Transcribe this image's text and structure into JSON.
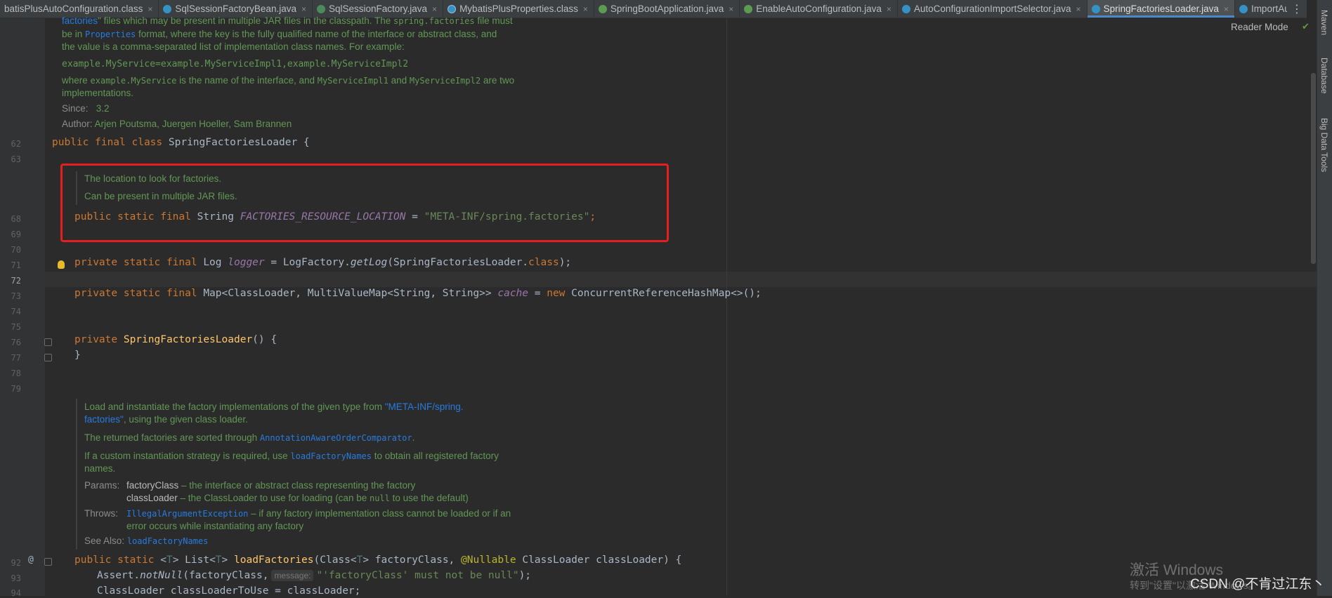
{
  "tabs": [
    {
      "label": "batisPlusAutoConfiguration.class",
      "icon": "class-file-icon"
    },
    {
      "label": "SqlSessionFactoryBean.java",
      "icon": "class-icon"
    },
    {
      "label": "SqlSessionFactory.java",
      "icon": "interface-icon"
    },
    {
      "label": "MybatisPlusProperties.class",
      "icon": "class-file-icon"
    },
    {
      "label": "SpringBootApplication.java",
      "icon": "annotation-icon"
    },
    {
      "label": "EnableAutoConfiguration.java",
      "icon": "annotation-icon"
    },
    {
      "label": "AutoConfigurationImportSelector.java",
      "icon": "class-icon"
    },
    {
      "label": "SpringFactoriesLoader.java",
      "icon": "class-icon",
      "active": true
    },
    {
      "label": "ImportAutoC",
      "icon": "class-icon"
    }
  ],
  "tab_close_glyph": "×",
  "more_glyph": "⋮",
  "reader_mode": "Reader Mode",
  "right_tools": [
    "Maven",
    "Database",
    "Big Data Tools"
  ],
  "class_doc": {
    "l1_link": "factories",
    "l1_rest": "\" files which may be present in multiple JAR files in the classpath. The ",
    "l1_mono": "spring.factories",
    "l1_end": " file must",
    "l2_a": "be in ",
    "l2_link": "Properties",
    "l2_b": " format, where the key is the fully qualified name of the interface or abstract class, and",
    "l3": "the value is a comma-separated list of implementation class names. For example:",
    "example": "example.MyService=example.MyServiceImpl1,example.MyServiceImpl2",
    "l5_a": "where ",
    "l5_m1": "example.MyService",
    "l5_b": " is the name of the interface, and ",
    "l5_m2": "MyServiceImpl1",
    "l5_c": " and ",
    "l5_m3": "MyServiceImpl2",
    "l5_d": " are two",
    "l6": "implementations.",
    "since_label": "Since:",
    "since_value": "3.2",
    "author_label": "Author:",
    "author_value": "Arjen Poutsma, Juergen Hoeller, Sam Brannen"
  },
  "line_numbers": {
    "l62": "62",
    "l63": "63",
    "l68": "68",
    "l69": "69",
    "l70": "70",
    "l71": "71",
    "l72": "72",
    "l73": "73",
    "l74": "74",
    "l75": "75",
    "l76": "76",
    "l77": "77",
    "l78": "78",
    "l79": "79",
    "l92": "92",
    "l93": "93",
    "l94": "94"
  },
  "code": {
    "l62_kw": "public final class ",
    "l62_name": "SpringFactoriesLoader {",
    "doc1_a": "The location to look for factories.",
    "doc1_b": "Can be present in multiple JAR files.",
    "l68_kw": "public static final ",
    "l68_type": "String ",
    "l68_field": "FACTORIES_RESOURCE_LOCATION",
    "l68_eq": " = ",
    "l68_str": "\"META-INF/spring.factories\"",
    "l68_end": ";",
    "l71_kw": "private static final ",
    "l71_type": "Log ",
    "l71_field": "logger",
    "l71_mid": " = LogFactory.",
    "l71_m": "getLog",
    "l71_arg": "(SpringFactoriesLoader.",
    "l71_cls": "class",
    "l71_end": ");",
    "l73_kw": "private static final ",
    "l73_type": "Map<ClassLoader, MultiValueMap<String, String>> ",
    "l73_field": "cache",
    "l73_eq": " = ",
    "l73_new": "new ",
    "l73_rest": "ConcurrentReferenceHashMap<>();",
    "l76_kw": "private ",
    "l76_name": "SpringFactoriesLoader",
    "l76_end": "() {",
    "l77": "}",
    "doc2": {
      "p1_a": "Load and instantiate the factory implementations of the given type from ",
      "p1_link": "\"META-INF/spring.",
      "p1_link2": "factories\"",
      "p1_b": ", using the given class loader.",
      "p2_a": "The returned factories are sorted through ",
      "p2_link": "AnnotationAwareOrderComparator",
      "p2_b": ".",
      "p3_a": "If a custom instantiation strategy is required, use ",
      "p3_link": "loadFactoryNames",
      "p3_b": " to obtain all registered factory",
      "p3_c": "names.",
      "params_label": "Params:",
      "param1_name": "factoryClass",
      "param1_desc": " – the interface or abstract class representing the factory",
      "param2_name": "classLoader",
      "param2_desc_a": " – the ClassLoader to use for loading (can be ",
      "param2_null": "null",
      "param2_desc_b": " to use the default)",
      "throws_label": "Throws:",
      "throws_link": "IllegalArgumentException",
      "throws_desc": " – if any factory implementation class cannot be loaded or if an",
      "throws_desc2": "error occurs while instantiating any factory",
      "seealso_label": "See Also:",
      "seealso_link": "loadFactoryNames"
    },
    "l92_kw": "public static ",
    "l92_t1": "<",
    "l92_T": "T",
    "l92_t2": "> List<",
    "l92_T2": "T",
    "l92_t3": "> ",
    "l92_m": "loadFactories",
    "l92_p1": "(Class<",
    "l92_T3": "T",
    "l92_p2": "> factoryClass, ",
    "l92_ann": "@Nullable",
    "l92_p3": " ClassLoader classLoader) {",
    "l93_a": "Assert.",
    "l93_m": "notNull",
    "l93_b": "(factoryClass,",
    "l93_hint": "message:",
    "l93_str": "\"'factoryClass' must not be null\"",
    "l93_end": ");",
    "l94": "ClassLoader classLoaderToUse = classLoader;"
  },
  "gutter_at": "@",
  "watermark": {
    "line1": "激活 Windows",
    "line2": "转到\"设置\"以激活 Windows。"
  },
  "csdn": "CSDN @不肯过江东丶"
}
